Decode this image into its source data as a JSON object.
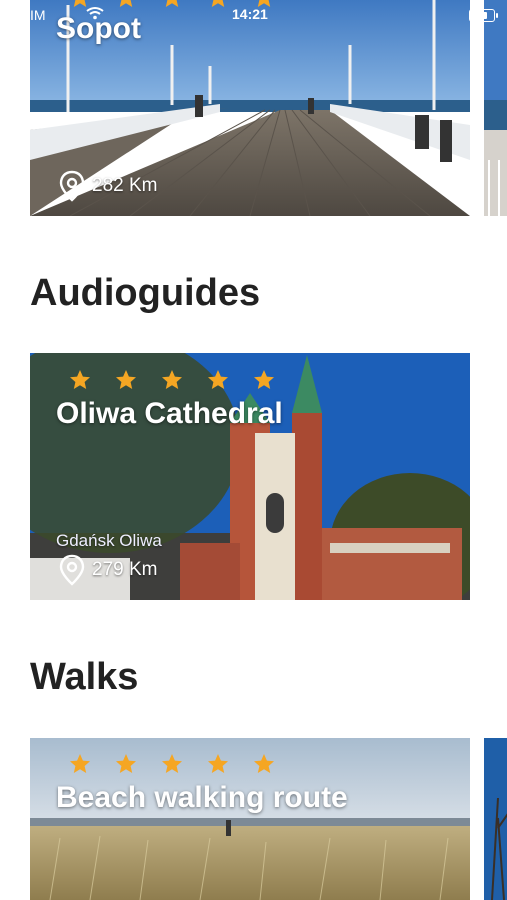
{
  "status": {
    "carrier": "ak SIM",
    "time": "14:21"
  },
  "cards": {
    "sopot": {
      "title": "Sopot",
      "distance": "282 Km"
    },
    "oliwa": {
      "title": "Oliwa Cathedral",
      "subtitle": "Gdańsk Oliwa",
      "distance": "279 Km",
      "rating": 5
    },
    "beach": {
      "title": "Beach walking route",
      "rating": 5
    }
  },
  "sections": {
    "audioguides": "Audioguides",
    "walks": "Walks"
  },
  "colors": {
    "star": "#f5a623",
    "text": "#222222"
  }
}
